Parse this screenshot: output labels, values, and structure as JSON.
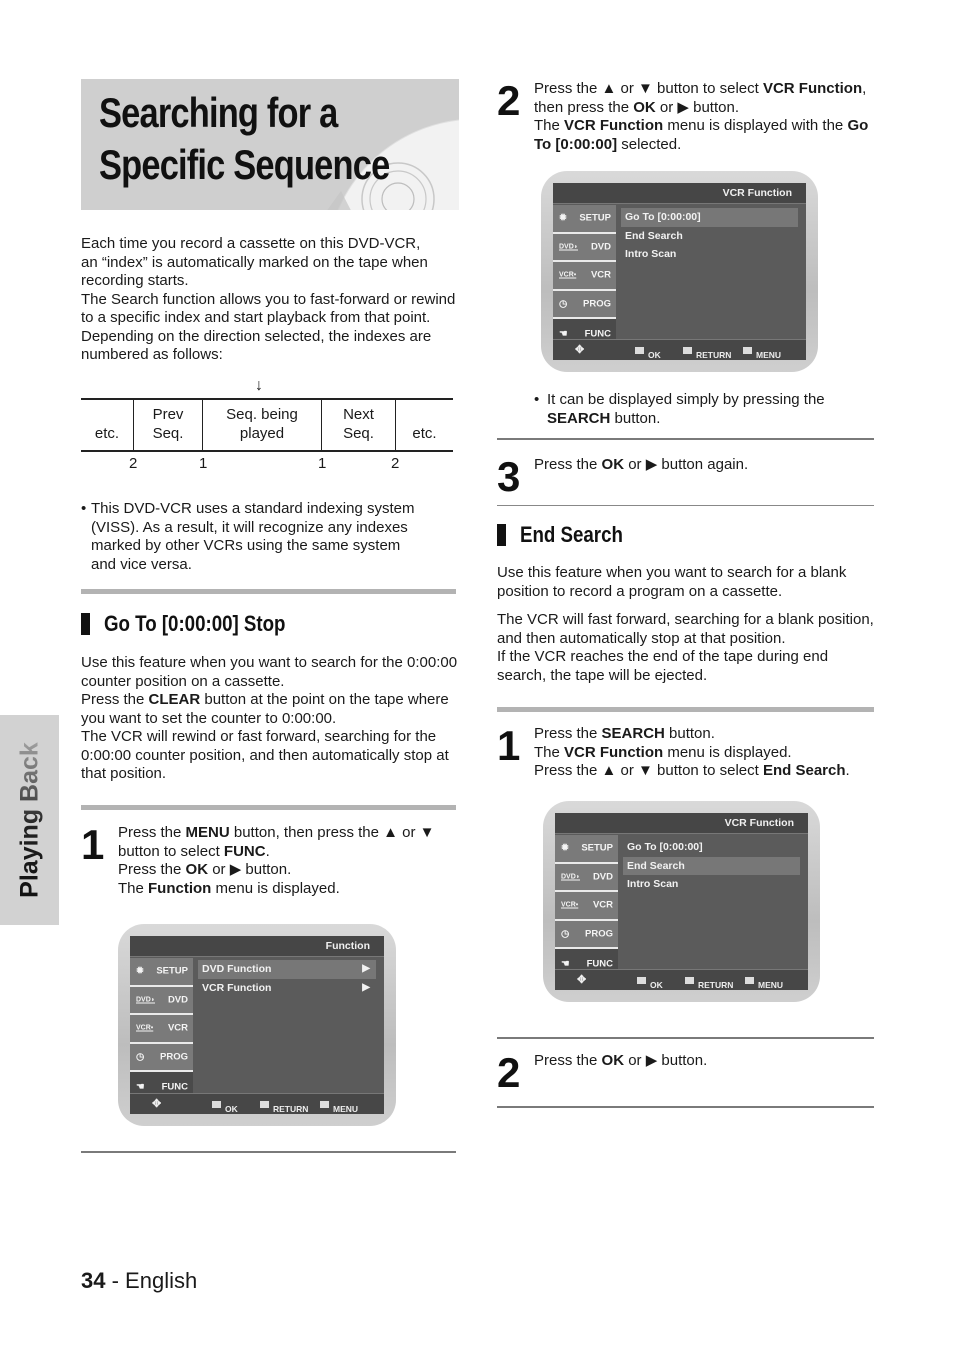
{
  "side_tab": {
    "label": "Playing Back"
  },
  "title": {
    "line1": "Searching for a",
    "line2": "Specific Sequence"
  },
  "intro": {
    "lines": [
      "Each time you record a cassette on this DVD-VCR,",
      "an “index” is automatically marked on the tape when",
      "recording starts.",
      "The Search function allows you to fast-forward or rewind",
      "to a specific index and start playback from that point.",
      "Depending on the direction selected, the indexes are",
      "numbered as follows:"
    ]
  },
  "sequence": {
    "arrow": "↓",
    "cells": [
      {
        "line1": "",
        "line2": "etc."
      },
      {
        "line1": "Prev",
        "line2": "Seq."
      },
      {
        "line1": "Seq. being",
        "line2": "played"
      },
      {
        "line1": "Next",
        "line2": "Seq."
      },
      {
        "line1": "",
        "line2": "etc."
      }
    ],
    "numbers": [
      "2",
      "1",
      "1",
      "2"
    ]
  },
  "note": {
    "bullet": "•",
    "lines": [
      "This DVD-VCR uses a standard indexing system",
      "(VISS). As a result, it will recognize any indexes",
      "marked by other VCRs using the same system",
      "and vice versa."
    ]
  },
  "goto_section": {
    "heading": "Go To [0:00:00] Stop",
    "p1a": "Use this feature when you want to search for the 0:00:00",
    "p1b": "counter position on a cassette.",
    "p2a_pre": "Press the ",
    "p2a_bold": "CLEAR",
    "p2a_post": " button at the point on the tape where",
    "p2b": "you want to set the counter to 0:00:00.",
    "p3a": "The VCR will rewind or fast forward, searching for the",
    "p3b": "0:00:00 counter position, and then automatically stop at",
    "p3c": "that position.",
    "step1": {
      "num": "1",
      "l1_pre": "Press the ",
      "l1_b1": "MENU",
      "l1_mid": " button, then press the ▲ or ▼",
      "l2_pre": "button to select ",
      "l2_b": "FUNC",
      "l2_post": ".",
      "l3_pre": "Press the ",
      "l3_b": "OK",
      "l3_post": " or ▶ button.",
      "l4_pre": "The ",
      "l4_b": "Function",
      "l4_post": " menu is displayed."
    },
    "step2": {
      "num": "2",
      "l1_pre": "Press the ▲ or ▼ button to select ",
      "l1_b": "VCR Function",
      "l1_post": ",",
      "l2_pre": "then press the ",
      "l2_b": "OK",
      "l2_post": " or ▶ button.",
      "l3_pre": "The ",
      "l3_b": "VCR Function",
      "l3_mid": " menu is displayed with the ",
      "l3_b2": "Go",
      "l4_b": "To [0:00:00]",
      "l4_post": " selected."
    },
    "bullet_note": {
      "bullet": "•",
      "l1": "It can be displayed simply by pressing the",
      "l2_b": "SEARCH",
      "l2_post": " button."
    },
    "step3": {
      "num": "3",
      "l1_pre": "Press the ",
      "l1_b": "OK",
      "l1_post": " or ▶ button again."
    }
  },
  "end_section": {
    "heading": "End Search",
    "p1a": "Use this feature when you want to search for a blank",
    "p1b": "position to record a program on a cassette.",
    "p2a": "The VCR will fast forward, searching for a blank position,",
    "p2b": "and then automatically stop at that position.",
    "p2c": "If the VCR reaches the end of the tape during end",
    "p2d": "search, the tape will be ejected.",
    "step1": {
      "num": "1",
      "l1_pre": "Press the ",
      "l1_b": "SEARCH",
      "l1_post": " button.",
      "l2_pre": "The ",
      "l2_b": "VCR Function",
      "l2_post": " menu is displayed.",
      "l3_pre": "Press the ▲ or ▼ button to select ",
      "l3_b": "End Search",
      "l3_post": "."
    },
    "step2": {
      "num": "2",
      "l1_pre": "Press the ",
      "l1_b": "OK",
      "l1_post": " or ▶ button."
    }
  },
  "osd_common": {
    "sidebar": [
      "SETUP",
      "DVD",
      "VCR",
      "PROG",
      "FUNC"
    ],
    "icons": [
      "gear",
      "dvd",
      "vcr",
      "clock",
      "hand"
    ],
    "footer": {
      "ok": "OK",
      "return": "RETURN",
      "menu": "MENU"
    }
  },
  "osd_function": {
    "title": "Function",
    "items": [
      {
        "label": "DVD Function",
        "arrow": "▶",
        "selected": true
      },
      {
        "label": "VCR Function",
        "arrow": "▶",
        "selected": false
      }
    ]
  },
  "osd_vcr_goto": {
    "title": "VCR Function",
    "items": [
      {
        "label": "Go To [0:00:00]",
        "selected": true
      },
      {
        "label": "End Search",
        "selected": false
      },
      {
        "label": "Intro Scan",
        "selected": false
      }
    ]
  },
  "osd_vcr_end": {
    "title": "VCR Function",
    "items": [
      {
        "label": "Go To [0:00:00]",
        "selected": false
      },
      {
        "label": "End Search",
        "selected": true
      },
      {
        "label": "Intro Scan",
        "selected": false
      }
    ]
  },
  "footer": {
    "page": "34",
    "sep": " - ",
    "lang": "English"
  }
}
